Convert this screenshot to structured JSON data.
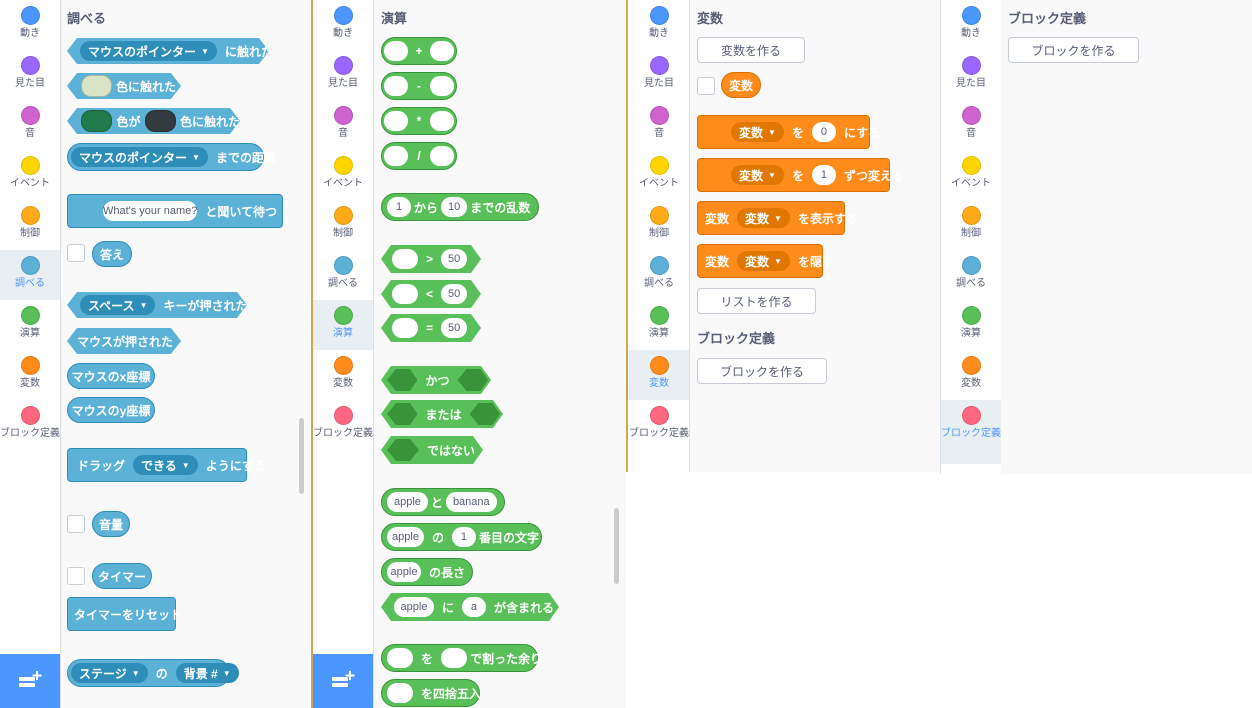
{
  "categories": [
    {
      "label": "動き",
      "color": "#4c97ff"
    },
    {
      "label": "見た目",
      "color": "#9966ff"
    },
    {
      "label": "音",
      "color": "#cf63cf"
    },
    {
      "label": "イベント",
      "color": "#ffd500"
    },
    {
      "label": "制御",
      "color": "#ffab19"
    },
    {
      "label": "調べる",
      "color": "#5cb1d6"
    },
    {
      "label": "演算",
      "color": "#59c059"
    },
    {
      "label": "変数",
      "color": "#ff8c1a"
    },
    {
      "label": "ブロック定義",
      "color": "#ff6680"
    }
  ],
  "sensing": {
    "title": "調べる",
    "touching_dd": "マウスのポインター",
    "touching_text": "に触れた",
    "color_touch": "色に触れた",
    "color_swatch": "#d9e3c6",
    "color_a": "色が",
    "color_b": "色に触れた",
    "swatch_a": "#217a4b",
    "swatch_b": "#333a40",
    "distance_dd": "マウスのポインター",
    "distance_text": "までの距離",
    "ask_input": "What's your name?",
    "ask_text": "と聞いて待つ",
    "answer": "答え",
    "key_dd": "スペース",
    "key_text": "キーが押された",
    "mouse_down": "マウスが押された",
    "mouse_x": "マウスのx座標",
    "mouse_y": "マウスのy座標",
    "drag_a": "ドラッグ",
    "drag_dd": "できる",
    "drag_b": "ようにする",
    "loudness": "音量",
    "timer": "タイマー",
    "reset_timer": "タイマーをリセット",
    "of_dd": "ステージ",
    "of_text": "の",
    "of_dd2": "背景 #"
  },
  "operators": {
    "title": "演算",
    "plus": "+",
    "minus": "-",
    "times": "*",
    "divide": "/",
    "rand_from": "1",
    "rand_a": "から",
    "rand_to": "10",
    "rand_b": "までの乱数",
    "gt": ">",
    "lt": "<",
    "eq": "=",
    "cmp_val": "50",
    "and": "かつ",
    "or": "または",
    "not": "ではない",
    "join_a": "apple",
    "join_t": "と",
    "join_b": "banana",
    "letter_s": "apple",
    "letter_t1": "の",
    "letter_n": "1",
    "letter_t2": "番目の文字",
    "length_s": "apple",
    "length_t": "の長さ",
    "contains_s": "apple",
    "contains_t1": "に",
    "contains_c": "a",
    "contains_t2": "が含まれる",
    "mod_t1": "を",
    "mod_t2": "で割った余り",
    "round_t": "を四捨五入"
  },
  "variables": {
    "title": "変数",
    "make_var": "変数を作る",
    "var_name": "変数",
    "set_dd": "変数",
    "set_t1": "を",
    "set_val": "0",
    "set_t2": "にする",
    "change_dd": "変数",
    "change_t1": "を",
    "change_val": "1",
    "change_t2": "ずつ変える",
    "show_t0": "変数",
    "show_dd": "変数",
    "show_t": "を表示する",
    "hide_t0": "変数",
    "hide_dd": "変数",
    "hide_t": "を隠す",
    "make_list": "リストを作る",
    "myblocks_title": "ブロック定義",
    "make_block": "ブロックを作る"
  },
  "myblocks": {
    "title": "ブロック定義",
    "make_block": "ブロックを作る"
  }
}
